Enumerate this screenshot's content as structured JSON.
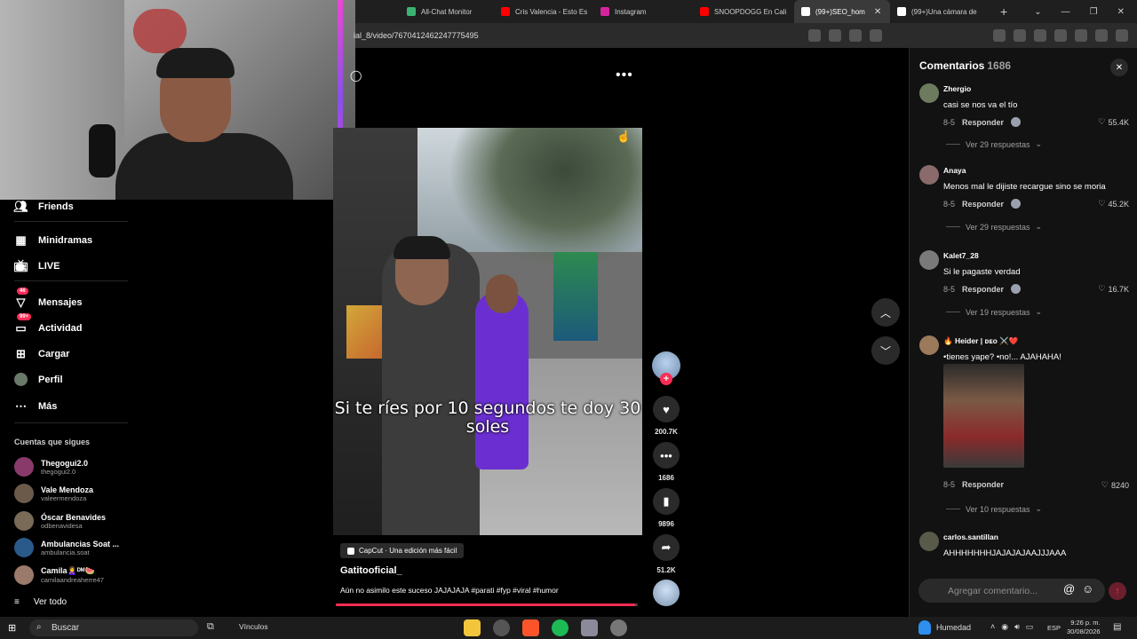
{
  "browser": {
    "tabs": [
      {
        "title": "All-Chat Monitor",
        "color": "#3bb273"
      },
      {
        "title": "Cris Valencia - Esto Es",
        "color": "#ff0000"
      },
      {
        "title": "Instagram",
        "color": "#d6249f"
      },
      {
        "title": "SNOOPDOGG En Cali",
        "color": "#ff0000"
      },
      {
        "title": "(99+)SEO_hom",
        "color": "#ffffff",
        "active": true
      },
      {
        "title": "(99+)Una cámara de",
        "color": "#ffffff"
      }
    ],
    "new_tab": "+",
    "url": "ial_8/video/7670412462247775495",
    "window_controls": {
      "dropdown": "⌄",
      "minimize": "—",
      "restore": "❐",
      "close": "✕"
    }
  },
  "nav": {
    "friends": "Friends",
    "minidramas": "Minidramas",
    "live": "LIVE",
    "messages": "Mensajes",
    "messages_badge": "46",
    "activity": "Actividad",
    "activity_badge": "99+",
    "upload": "Cargar",
    "profile": "Perfil",
    "more": "Más"
  },
  "following": {
    "title": "Cuentas que sigues",
    "accounts": [
      {
        "name": "Thegogui2.0",
        "handle": "thegogui2.0",
        "avatar_color": "#8a3a6a"
      },
      {
        "name": "Vale Mendoza",
        "handle": "valeermendoza",
        "avatar_color": "#6b5a4a"
      },
      {
        "name": "Óscar Benavides",
        "handle": "odbenavidesa",
        "avatar_color": "#7a6a58"
      },
      {
        "name": "Ambulancias Soat ...",
        "handle": "ambulancia.soat",
        "avatar_color": "#2a5a8a"
      },
      {
        "name": "Camila🙎‍♀️ᴰᴹ🍉",
        "handle": "camilaandreaherre47",
        "avatar_color": "#9a7a6a"
      }
    ],
    "see_all": "Ver todo"
  },
  "video": {
    "caption": "Si te ríes por 10 segundos te doy 30 soles",
    "capcut_label": "CapCut · Una edición más fácil",
    "author": "Gatitooficial_",
    "description": "Aún no asimilo este suceso JAJAJAJA #parati #fyp #viral #humor",
    "progress": 0.99,
    "more": "•••"
  },
  "actions": {
    "likes": "200.7K",
    "comments": "1686",
    "saves": "9896",
    "shares": "51.2K"
  },
  "comments_panel": {
    "title": "Comentarios",
    "count": "1686",
    "close": "✕",
    "items": [
      {
        "user": "Zhergio",
        "text": "casi se nos va el tío",
        "date": "8-5",
        "reply": "Responder",
        "likes": "55.4K",
        "replies": "Ver 29 respuestas",
        "avatar_color": "#6e7a5e"
      },
      {
        "user": "Anaya",
        "text": "Menos mal le dijiste recargue sino se moria",
        "date": "8-5",
        "reply": "Responder",
        "likes": "45.2K",
        "replies": "Ver 29 respuestas",
        "avatar_color": "#8a6a6a"
      },
      {
        "user": "Kalet7_28",
        "text": "Si le pagaste verdad",
        "date": "8-5",
        "reply": "Responder",
        "likes": "16.7K",
        "replies": "Ver 19 respuestas",
        "avatar_color": "#7a7a7a"
      },
      {
        "user": "🔥 Heider | ᴅᴇᴏ ⚔️❤️",
        "text": "•tienes yape? •no!... AJAHAHA!",
        "date": "8-5",
        "reply": "Responder",
        "likes": "8240",
        "replies": "Ver 10 respuestas",
        "avatar_color": "#9a7a5a"
      },
      {
        "user": "carlos.santillan",
        "text": "AHHHHHHHJAJAJAJAAJJJAAA",
        "avatar_color": "#5a5a4a"
      }
    ],
    "input_placeholder": "Agregar comentario...",
    "at": "@",
    "emoji": "☺",
    "send": "↑"
  },
  "taskbar": {
    "search": "Buscar",
    "links": "Vínculos",
    "weather": "Humedad",
    "lang": "ESP",
    "time": "9:26 p. m.",
    "date": "30/08/2026"
  }
}
